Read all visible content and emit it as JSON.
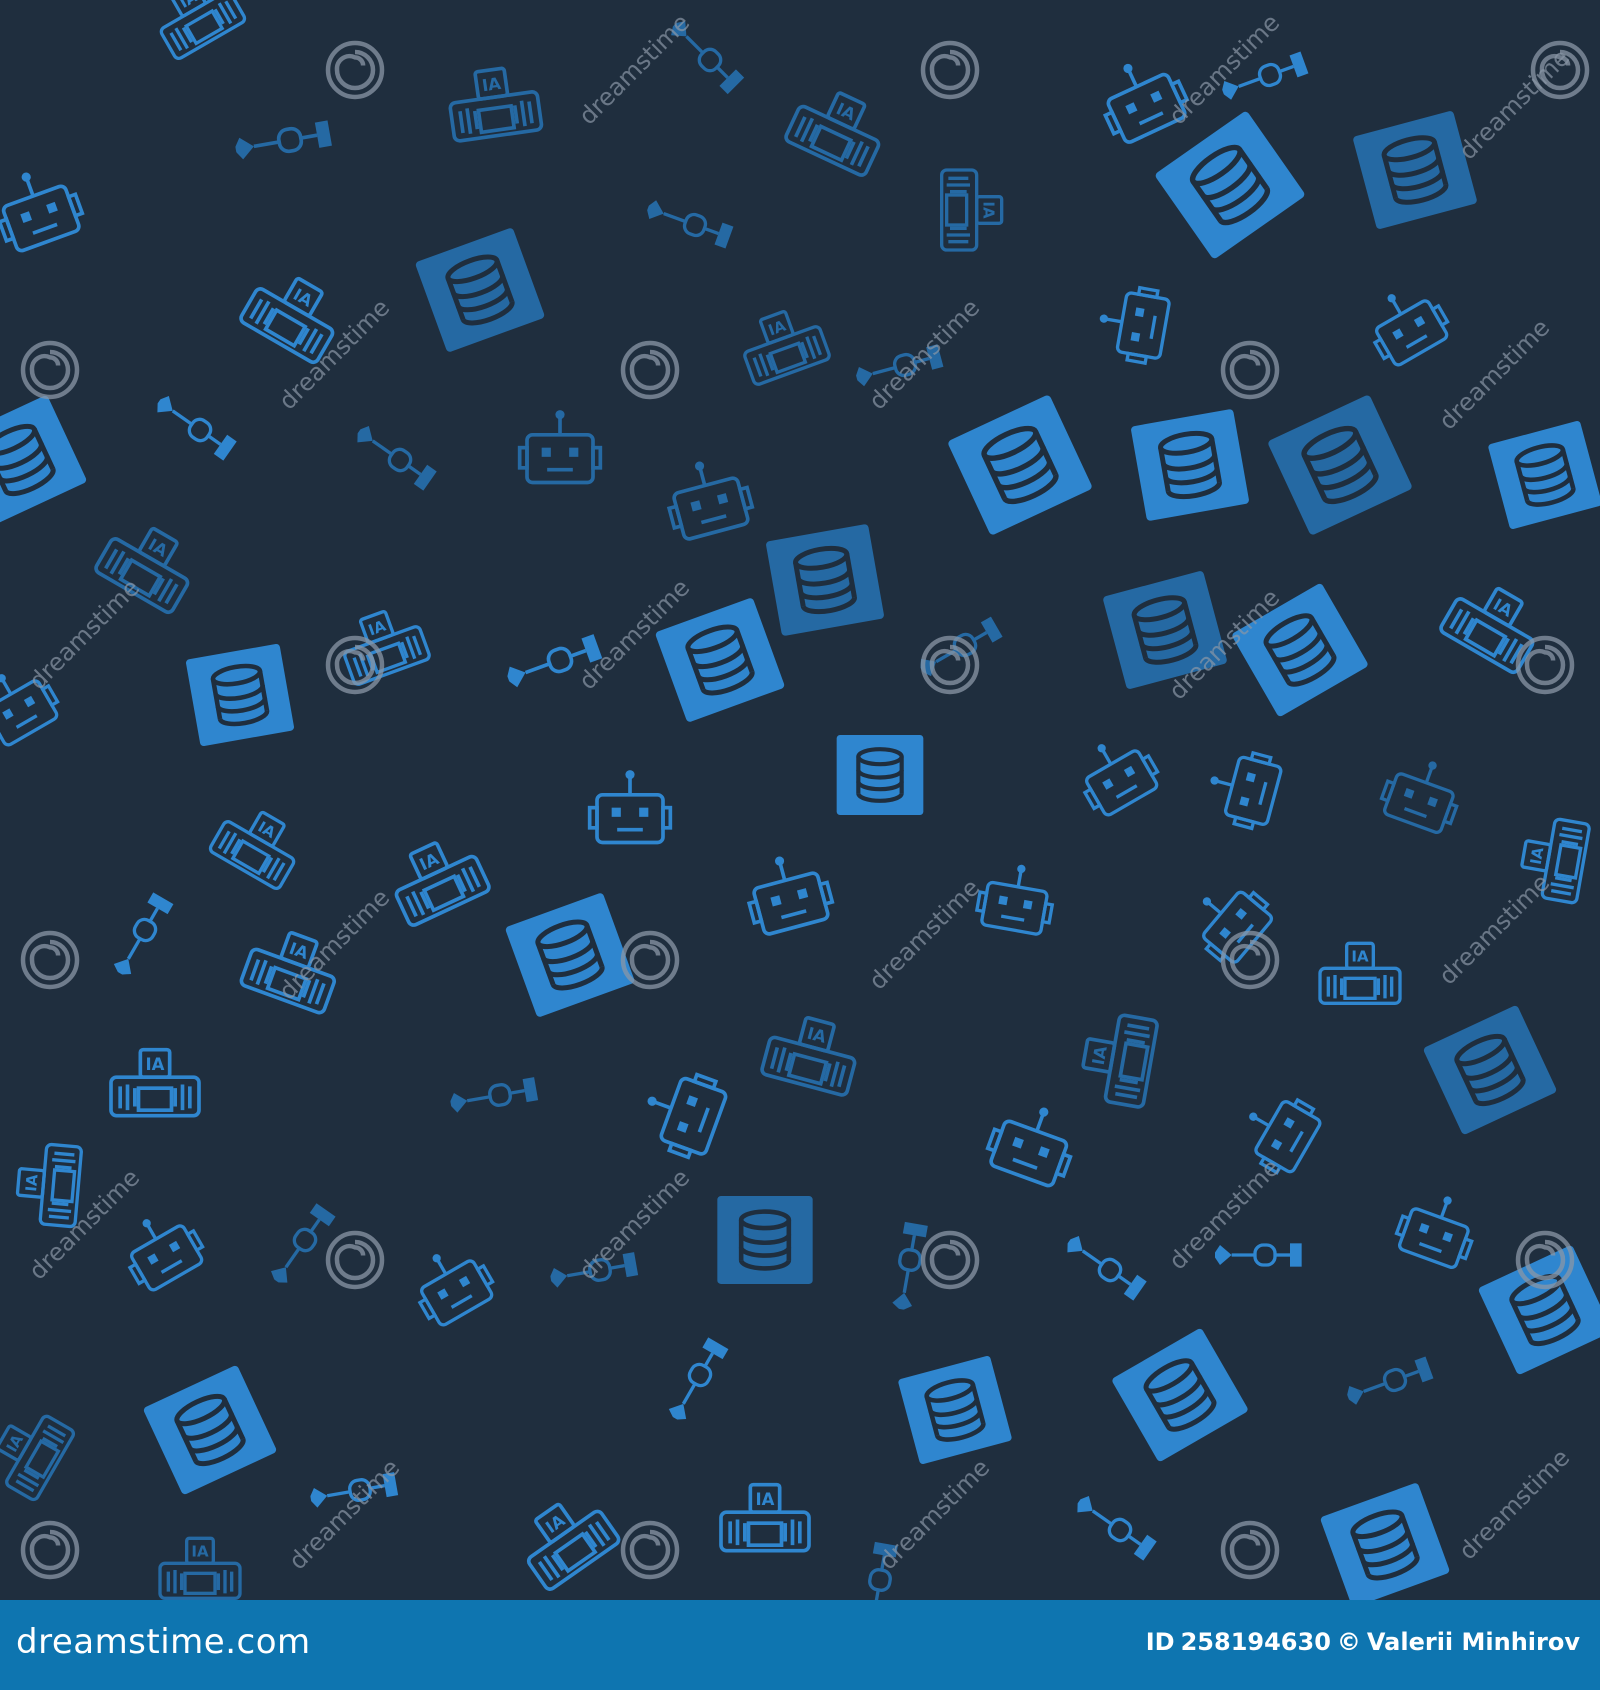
{
  "palette": {
    "background": "#1f2e3e",
    "icon_bright": "#2f86cf",
    "icon_dim": "#2569a3",
    "watermark": "#8a97a6",
    "footer_bg": "#0e75b0",
    "footer_text": "#ffffff"
  },
  "pattern": {
    "icon_types": [
      "robot-head-icon",
      "database-server-icon",
      "ia-chip-device-icon",
      "algorithm-flow-icon"
    ]
  },
  "watermark": {
    "text": "dreamstime",
    "logo_icon": "spiral-logo-icon"
  },
  "footer": {
    "site": "dreamstime.com",
    "id_label": "ID",
    "id_number": "258194630",
    "copyright_symbol": "©",
    "author": "Valerii Minhirov"
  }
}
